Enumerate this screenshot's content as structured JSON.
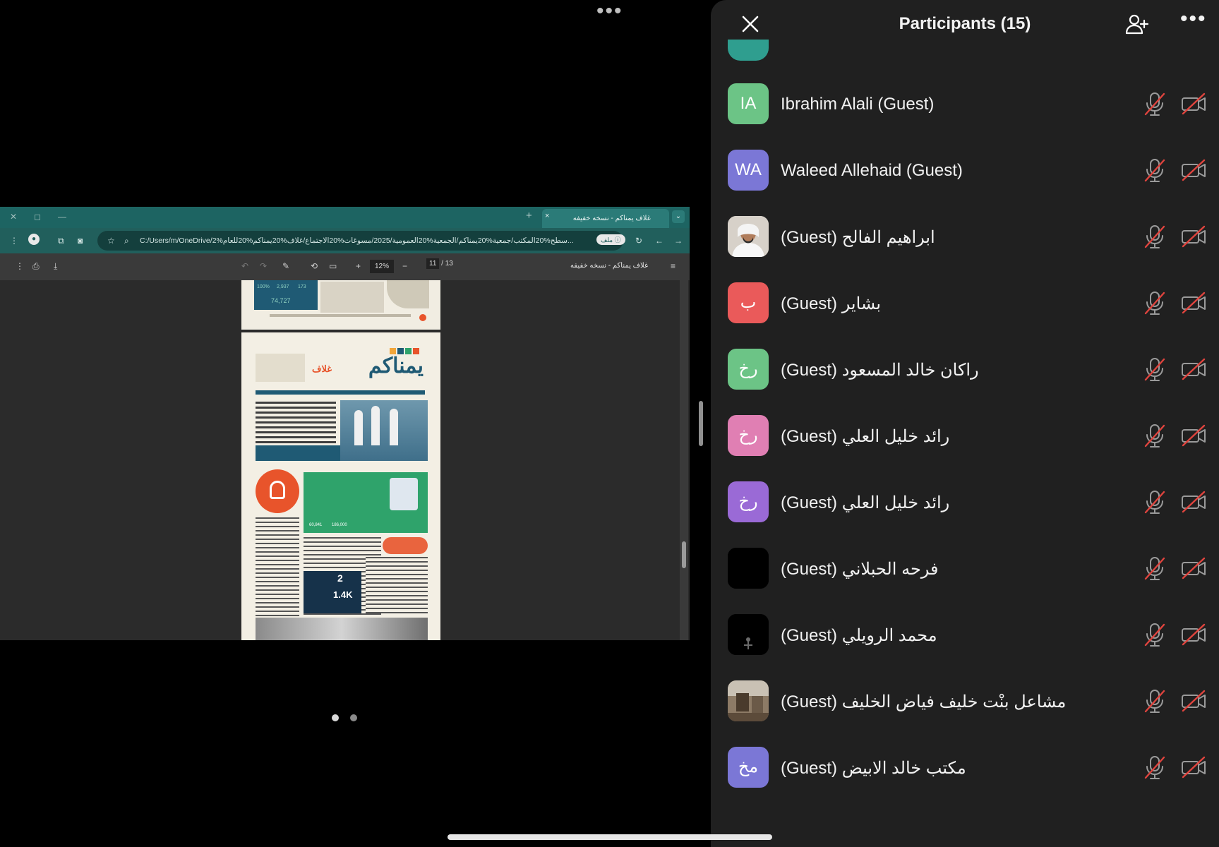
{
  "stage": {
    "more_label": "•••",
    "pager_dots": 2
  },
  "browser": {
    "tab_title": "غلاف يمناكم - نسخه خفيفه",
    "tab_close": "×",
    "tab_new": "+",
    "url": "C:/Users/m/OneDrive/سطح%20المكتب/جمعية%20يمناكم/الجمعية%20العمومية/2025/مسوغات%20الاجتماع/غلاف%20يمناكم%20للعام%2...",
    "file_label": "ملف"
  },
  "pdf_toolbar": {
    "zoom": "12%",
    "page_current": "11",
    "page_total": "/ 13",
    "doc_title": "غلاف يمناكم - نسخه خفيفه"
  },
  "pdf_art": {
    "stat1": "100%",
    "stat2": "2,937",
    "stat3": "173",
    "stat4": "74,727",
    "masthead": "يمناكم",
    "masthead_sub": "غلاف",
    "stat_a": "60,841",
    "stat_b": "186,000",
    "big_number": "2",
    "big_k": "1.4K"
  },
  "panel": {
    "title": "Participants (15)",
    "participants": [
      {
        "initials": "IA",
        "name": "Ibrahim Alali (Guest)",
        "color": "#6cc486",
        "photo": false
      },
      {
        "initials": "WA",
        "name": "Waleed Allehaid (Guest)",
        "color": "#7b77d6",
        "photo": false
      },
      {
        "initials": "",
        "name": "ابراهيم الفالح (Guest)",
        "color": "#d9d4cf",
        "photo": "man-portrait"
      },
      {
        "initials": "ب",
        "name": "بشاير (Guest)",
        "color": "#ea5a5a",
        "photo": false
      },
      {
        "initials": "رخ",
        "name": "راكان خالد المسعود (Guest)",
        "color": "#6cc486",
        "photo": false
      },
      {
        "initials": "رخ",
        "name": "رائد خليل العلي (Guest)",
        "color": "#e07fb3",
        "photo": false
      },
      {
        "initials": "رخ",
        "name": "رائد خليل العلي (Guest)",
        "color": "#9a6ad6",
        "photo": false
      },
      {
        "initials": "",
        "name": "فرحه الحبلاني (Guest)",
        "color": "#000000",
        "photo": "black"
      },
      {
        "initials": "",
        "name": "محمد الرويلي (Guest)",
        "color": "#000000",
        "photo": "emblem"
      },
      {
        "initials": "",
        "name": "مشاعل بنْت خليف فياض الخليف (Guest)",
        "color": "#6e5a46",
        "photo": "room"
      },
      {
        "initials": "مخ",
        "name": "مكتب خالد الابيض (Guest)",
        "color": "#7b77d6",
        "photo": false
      }
    ]
  }
}
